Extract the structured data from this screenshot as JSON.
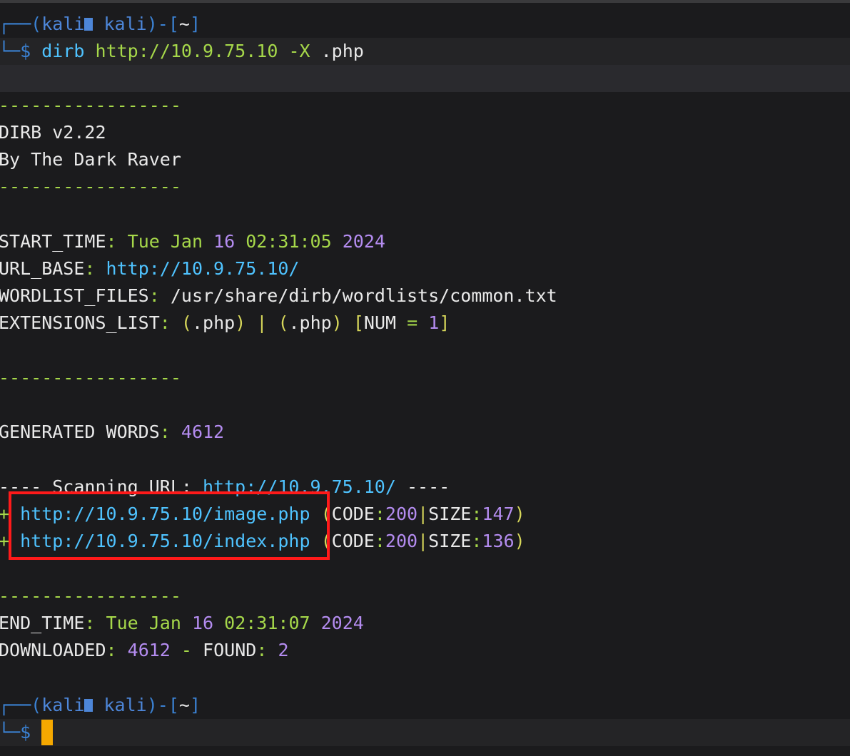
{
  "colors": {
    "background": "#1b1b1d",
    "prompt": "#4d86d8",
    "url": "#4fc3ff",
    "green": "#a6d84a",
    "purple": "#b48cf0",
    "cursor": "#f5a800",
    "highlight_box": "#ff1a1a"
  },
  "prompt1": {
    "top": "┌──(",
    "user": "kali",
    "host": "kali",
    "close": ")-[",
    "dir": "~",
    "end": "]",
    "dollar_prefix": "└─",
    "dollar": "$",
    "cmd": "dirb",
    "url": "http://10.9.75.10",
    "flag": "-X",
    "ext": ".php"
  },
  "output": {
    "separator": "-----------------",
    "title": "DIRB v2.22",
    "author": "By The Dark Raver",
    "start_time_label": "START_TIME",
    "start_time_day": "Tue Jan",
    "start_time_date": "16",
    "start_time_clock": "02:31:05",
    "start_time_year": "2024",
    "url_base_label": "URL_BASE",
    "url_base_value": "http://10.9.75.10/",
    "wordlist_label": "WORDLIST_FILES",
    "wordlist_value": "/usr/share/dirb/wordlists/common.txt",
    "extensions_label": "EXTENSIONS_LIST",
    "ext1": ".php",
    "ext2": ".php",
    "num_label": "NUM",
    "num_value": "1",
    "generated_label": "GENERATED WORDS",
    "generated_value": "4612",
    "scanning_prefix": "---- Scanning URL: ",
    "scanning_url": "http://10.9.75.10/",
    "scanning_suffix": " ----",
    "results": [
      {
        "marker": "+",
        "url": "http://10.9.75.10/image.php",
        "code": "200",
        "size": "147"
      },
      {
        "marker": "+",
        "url": "http://10.9.75.10/index.php",
        "code": "200",
        "size": "136"
      }
    ],
    "code_label": "CODE",
    "size_label": "SIZE",
    "end_time_label": "END_TIME",
    "end_time_day": "Tue Jan",
    "end_time_date": "16",
    "end_time_clock": "02:31:07",
    "end_time_year": "2024",
    "downloaded_label": "DOWNLOADED",
    "downloaded_value": "4612",
    "found_label": "FOUND",
    "found_value": "2"
  },
  "prompt2": {
    "top": "┌──(",
    "user": "kali",
    "host": "kali",
    "close": ")-[",
    "dir": "~",
    "end": "]",
    "dollar_prefix": "└─",
    "dollar": "$"
  }
}
